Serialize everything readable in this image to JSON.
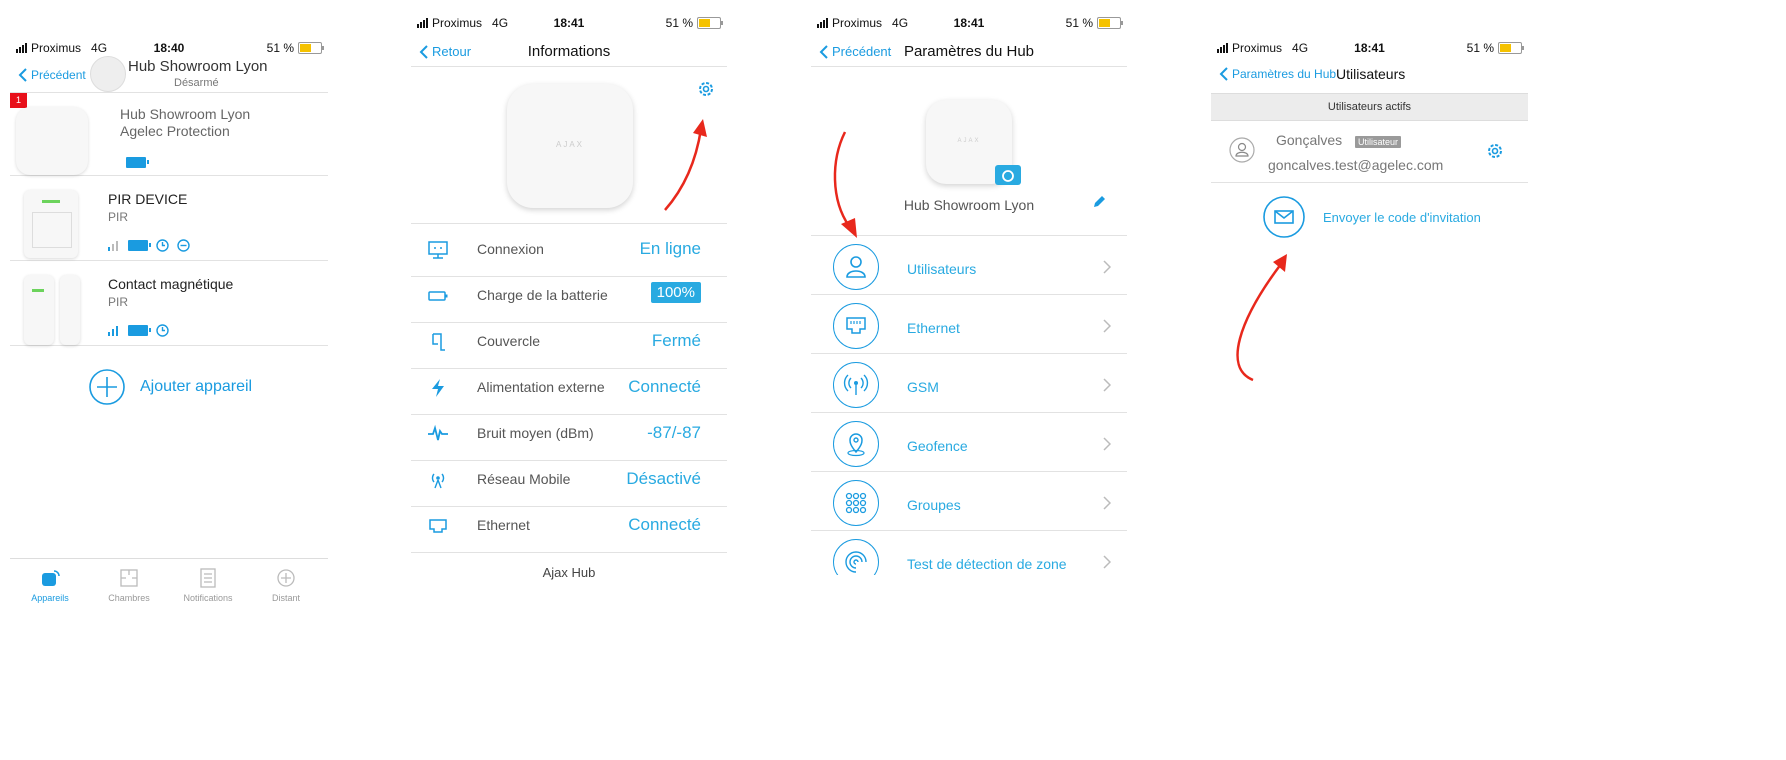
{
  "status": {
    "carrier": "Proximus",
    "network": "4G",
    "battery": "51 %",
    "times": [
      "18:40",
      "18:41",
      "18:41",
      "18:41"
    ]
  },
  "screen1": {
    "back": "Précédent",
    "title": "Hub Showroom Lyon",
    "subtitle": "Désarmé",
    "badge": "1",
    "devices": [
      {
        "name": "Hub Showroom Lyon",
        "sub": "Agelec Protection"
      },
      {
        "name": "PIR DEVICE",
        "sub": "PIR"
      },
      {
        "name": "Contact magnétique",
        "sub": "PIR"
      }
    ],
    "add_device": "Ajouter appareil",
    "tabs": [
      "Appareils",
      "Chambres",
      "Notifications",
      "Distant"
    ]
  },
  "screen2": {
    "back": "Retour",
    "title": "Informations",
    "hub_logo": "AJAX",
    "rows": [
      {
        "label": "Connexion",
        "value": "En ligne",
        "icon": "connection-icon"
      },
      {
        "label": "Charge de la batterie",
        "value": "100%",
        "icon": "battery-icon"
      },
      {
        "label": "Couvercle",
        "value": "Fermé",
        "icon": "lid-icon"
      },
      {
        "label": "Alimentation externe",
        "value": "Connecté",
        "icon": "power-icon"
      },
      {
        "label": "Bruit moyen (dBm)",
        "value": "-87/-87",
        "icon": "noise-icon"
      },
      {
        "label": "Réseau Mobile",
        "value": "Désactivé",
        "icon": "antenna-icon"
      },
      {
        "label": "Ethernet",
        "value": "Connecté",
        "icon": "ethernet-icon"
      }
    ],
    "footer": "Ajax Hub"
  },
  "screen3": {
    "back": "Précédent",
    "title": "Paramètres du Hub",
    "hub_logo": "AJAX",
    "hub_name": "Hub Showroom Lyon",
    "items": [
      {
        "label": "Utilisateurs",
        "icon": "user-icon"
      },
      {
        "label": "Ethernet",
        "icon": "ethernet-icon"
      },
      {
        "label": "GSM",
        "icon": "gsm-icon"
      },
      {
        "label": "Geofence",
        "icon": "location-pin-icon"
      },
      {
        "label": "Groupes",
        "icon": "groups-icon"
      },
      {
        "label": "Test de détection de zone",
        "icon": "zone-test-icon"
      }
    ]
  },
  "screen4": {
    "back": "Paramètres du Hub",
    "title": "Utilisateurs",
    "section": "Utilisateurs actifs",
    "user_name": "Gonçalves",
    "user_role": "Utilisateur",
    "user_email": "goncalves.test@agelec.com",
    "invite": "Envoyer le code d'invitation"
  },
  "colors": {
    "accent": "#1a9be0",
    "value": "#29aae1",
    "annotation_arrow": "#e8281c",
    "badge": "#e8101a"
  }
}
